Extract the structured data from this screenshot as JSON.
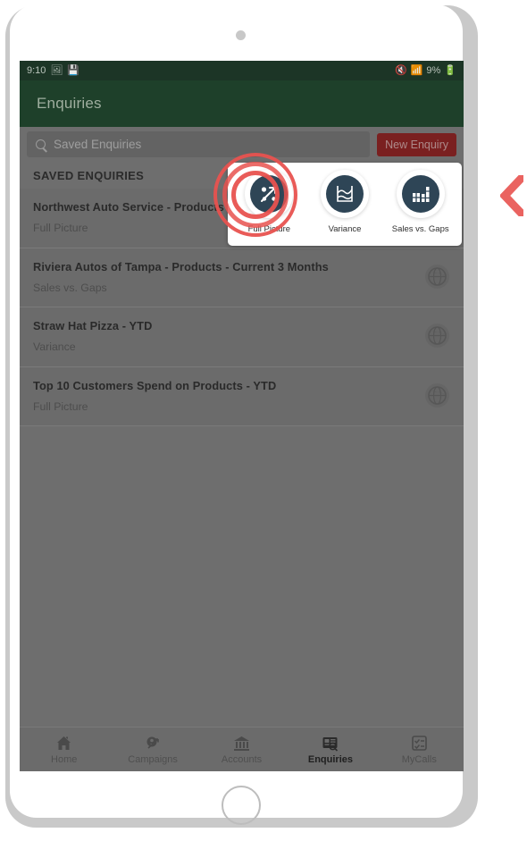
{
  "device": {
    "camera_icon": "camera-dot",
    "home_button_icon": "home-circle-button"
  },
  "status_bar": {
    "time": "9:10",
    "left_icons": [
      "image-icon",
      "save-icon"
    ],
    "right_icons": [
      "mute-icon",
      "wifi-icon",
      "battery-icon"
    ],
    "battery": "9%"
  },
  "app_bar": {
    "title": "Enquiries",
    "background": "#1e402a"
  },
  "search": {
    "placeholder": "Saved Enquiries",
    "value": "",
    "icon": "search-icon"
  },
  "actions": {
    "new_enquiry_label": "New Enquiry",
    "new_enquiry_color": "#7a2020"
  },
  "section": {
    "header": "SAVED ENQUIRIES"
  },
  "enquiries": [
    {
      "title": "Northwest Auto Service - Products - YTD",
      "subtitle": "Full Picture",
      "icon": "globe-icon"
    },
    {
      "title": "Riviera Autos of Tampa - Products - Current 3 Months",
      "subtitle": "Sales vs. Gaps",
      "icon": "globe-icon"
    },
    {
      "title": "Straw Hat Pizza - YTD",
      "subtitle": "Variance",
      "icon": "globe-icon"
    },
    {
      "title": "Top 10 Customers Spend on Products - YTD",
      "subtitle": "Full Picture",
      "icon": "globe-icon"
    }
  ],
  "popup": {
    "options": [
      {
        "label": "Full Picture",
        "icon": "trend-scatter-icon",
        "highlighted": true
      },
      {
        "label": "Variance",
        "icon": "line-chart-icon",
        "highlighted": false
      },
      {
        "label": "Sales vs. Gaps",
        "icon": "bar-chart-icon",
        "highlighted": false
      }
    ],
    "highlight_color": "#e8524f"
  },
  "bottom_nav": {
    "items": [
      {
        "label": "Home",
        "icon": "home-icon",
        "active": false
      },
      {
        "label": "Campaigns",
        "icon": "campaign-icon",
        "active": false
      },
      {
        "label": "Accounts",
        "icon": "bank-icon",
        "active": false
      },
      {
        "label": "Enquiries",
        "icon": "enquiries-icon",
        "active": true
      },
      {
        "label": "MyCalls",
        "icon": "checklist-icon",
        "active": false
      }
    ]
  },
  "annotation": {
    "chevron_icon": "chevron-left-icon",
    "chevron_color": "#ea6360"
  }
}
